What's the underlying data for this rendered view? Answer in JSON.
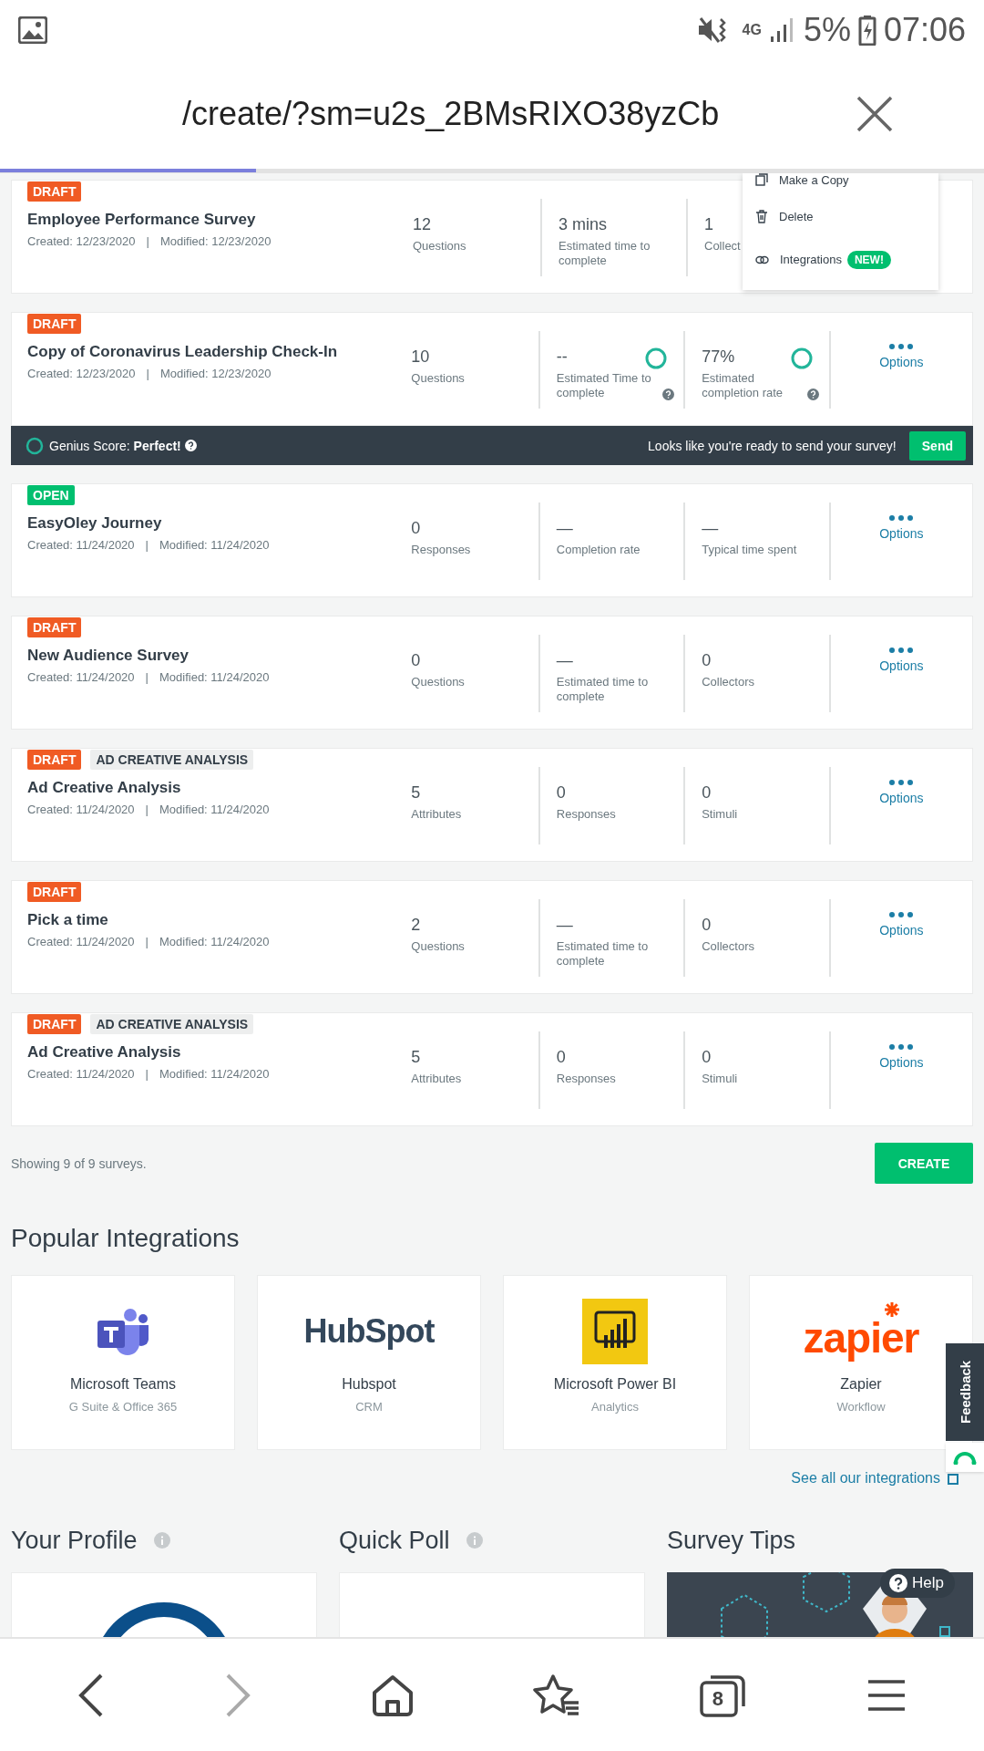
{
  "status_bar": {
    "network": "4G",
    "battery": "5%",
    "time": "07:06"
  },
  "browser": {
    "url": "/create/?sm=u2s_2BMsRIXO38yzCb",
    "load_progress": {
      "level": 0.26
    }
  },
  "surveys": [
    {
      "badges": [
        {
          "label": "DRAFT",
          "kind": "status",
          "color": "#f05b24"
        }
      ],
      "title": "Employee Performance Survey",
      "created": "Created: 12/23/2020",
      "separator": "|",
      "modified": "Modified: 12/23/2020",
      "stats": [
        {
          "value": "12",
          "label": "Questions"
        },
        {
          "value": "3 mins",
          "label": "Estimated time to complete"
        },
        {
          "value": "1",
          "label": "Collect"
        }
      ]
    },
    {
      "badges": [
        {
          "label": "DRAFT",
          "kind": "status",
          "color": "#f05b24"
        }
      ],
      "title": "Copy of Coronavirus Leadership Check-In",
      "created": "Created: 12/23/2020",
      "separator": "|",
      "modified": "Modified: 12/23/2020",
      "stats": [
        {
          "value": "10",
          "label": "Questions"
        },
        {
          "value": "--",
          "label": "Estimated Time to complete",
          "ring": true,
          "help": true
        },
        {
          "value": "77%",
          "label": "Estimated completion rate",
          "ring": true,
          "help": true
        }
      ],
      "options": "Options",
      "genius_bar": {
        "label": "Genius Score: **Perfect!**",
        "message": "Looks like you're ready to send your survey!",
        "button": "Send"
      }
    },
    {
      "badges": [
        {
          "label": "OPEN",
          "kind": "status",
          "color": "#00bf6f"
        }
      ],
      "title": "EasyOley Journey",
      "created": "Created: 11/24/2020",
      "separator": "|",
      "modified": "Modified: 11/24/2020",
      "stats": [
        {
          "value": "0",
          "label": "Responses"
        },
        {
          "value": "—",
          "label": "Completion rate"
        },
        {
          "value": "—",
          "label": "Typical time spent"
        }
      ],
      "options": "Options"
    },
    {
      "badges": [
        {
          "label": "DRAFT",
          "kind": "status",
          "color": "#f05b24"
        }
      ],
      "title": "New Audience Survey",
      "created": "Created: 11/24/2020",
      "separator": "|",
      "modified": "Modified: 11/24/2020",
      "stats": [
        {
          "value": "0",
          "label": "Questions"
        },
        {
          "value": "—",
          "label": "Estimated time to complete"
        },
        {
          "value": "0",
          "label": "Collectors"
        }
      ],
      "options": "Options"
    },
    {
      "badges": [
        {
          "label": "DRAFT",
          "kind": "status",
          "color": "#f05b24"
        },
        {
          "label": "AD CREATIVE ANALYSIS",
          "kind": "type"
        }
      ],
      "title": "Ad Creative Analysis",
      "created": "Created: 11/24/2020",
      "separator": "|",
      "modified": "Modified: 11/24/2020",
      "stats": [
        {
          "value": "5",
          "label": "Attributes"
        },
        {
          "value": "0",
          "label": "Responses"
        },
        {
          "value": "0",
          "label": "Stimuli"
        }
      ],
      "options": "Options"
    },
    {
      "badges": [
        {
          "label": "DRAFT",
          "kind": "status",
          "color": "#f05b24"
        }
      ],
      "title": "Pick a time",
      "created": "Created: 11/24/2020",
      "separator": "|",
      "modified": "Modified: 11/24/2020",
      "stats": [
        {
          "value": "2",
          "label": "Questions"
        },
        {
          "value": "—",
          "label": "Estimated time to complete"
        },
        {
          "value": "0",
          "label": "Collectors"
        }
      ],
      "options": "Options"
    },
    {
      "badges": [
        {
          "label": "DRAFT",
          "kind": "status",
          "color": "#f05b24"
        },
        {
          "label": "AD CREATIVE ANALYSIS",
          "kind": "type"
        }
      ],
      "title": "Ad Creative Analysis",
      "created": "Created: 11/24/2020",
      "separator": "|",
      "modified": "Modified: 11/24/2020",
      "stats": [
        {
          "value": "5",
          "label": "Attributes"
        },
        {
          "value": "0",
          "label": "Responses"
        },
        {
          "value": "0",
          "label": "Stimuli"
        }
      ],
      "options": "Options"
    }
  ],
  "options_menu": {
    "items": [
      {
        "label": "Make a Copy",
        "kind": "copy"
      },
      {
        "label": "Delete",
        "kind": "delete"
      },
      {
        "label": "Integrations",
        "kind": "link",
        "badge": "NEW!"
      }
    ]
  },
  "summary": {
    "showing": "Showing 9 of 9 surveys.",
    "create_button": "CREATE"
  },
  "integrations": {
    "title": "Popular Integrations",
    "items": [
      {
        "kind": "teams",
        "name": "Microsoft Teams",
        "category": "G Suite & Office 365"
      },
      {
        "kind": "hubspot",
        "logo_text": "HubSpot",
        "name": "Hubspot",
        "category": "CRM"
      },
      {
        "kind": "powerbi",
        "name": "Microsoft Power BI",
        "category": "Analytics"
      },
      {
        "kind": "zapier",
        "logo_text": "zapier",
        "name": "Zapier",
        "category": "Workflow"
      }
    ],
    "see_all": "See all our integrations"
  },
  "widgets": [
    {
      "title": "Your Profile",
      "info": true,
      "kind": "profile"
    },
    {
      "title": "Quick Poll",
      "info": true,
      "kind": "poll"
    },
    {
      "title": "Survey Tips",
      "info": false,
      "kind": "tips"
    }
  ],
  "feedback_tab": "Feedback",
  "help_button": "Help",
  "bottom_nav": {
    "tab_count": "8",
    "forward_disabled": true
  }
}
